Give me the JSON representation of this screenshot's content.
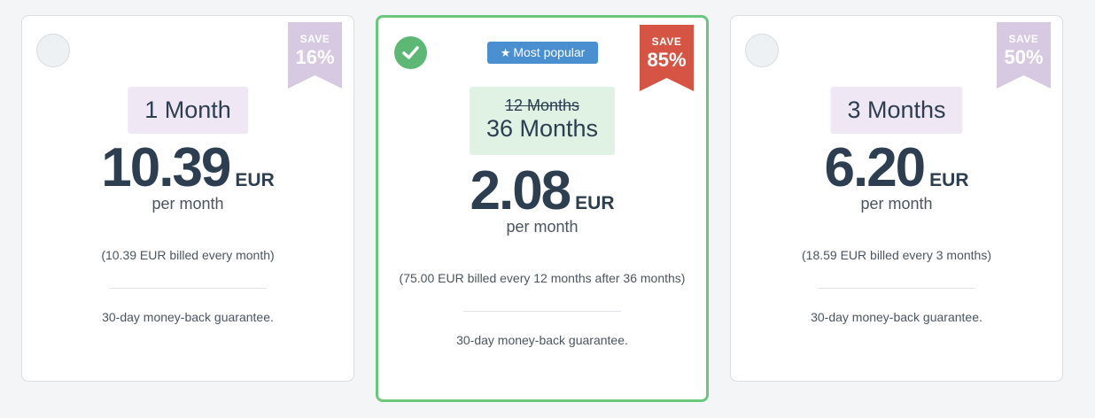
{
  "plans": [
    {
      "save_label": "SAVE",
      "save_percent": "16%",
      "term": "1 Month",
      "price": "10.39",
      "currency": "EUR",
      "period": "per month",
      "billing": "(10.39 EUR billed every month)",
      "guarantee": "30-day money-back guarantee.",
      "selected": false
    },
    {
      "badge_label": "Most popular",
      "badge_icon": "star-icon",
      "save_label": "SAVE",
      "save_percent": "85%",
      "term_original": "12 Months",
      "term": "36 Months",
      "price": "2.08",
      "currency": "EUR",
      "period": "per month",
      "billing": "(75.00 EUR billed every 12 months after 36 months)",
      "guarantee": "30-day money-back guarantee.",
      "selected": true
    },
    {
      "save_label": "SAVE",
      "save_percent": "50%",
      "term": "3 Months",
      "price": "6.20",
      "currency": "EUR",
      "period": "per month",
      "billing": "(18.59 EUR billed every 3 months)",
      "guarantee": "30-day money-back guarantee.",
      "selected": false
    }
  ],
  "colors": {
    "selected_border": "#6cc77e",
    "check": "#5cb874",
    "save_ribbon": "#d6c9e1",
    "save_ribbon_best": "#d65443",
    "badge": "#4a90d0",
    "term_box": "#efe8f4",
    "term_box_selected": "#dff2e4",
    "text": "#2c3e50"
  }
}
